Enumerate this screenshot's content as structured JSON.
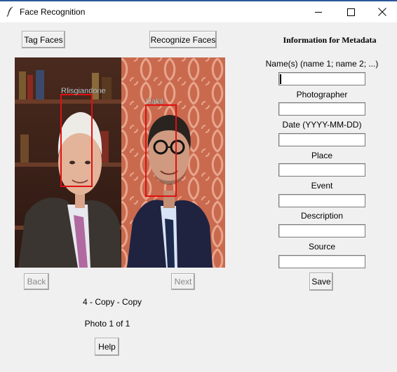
{
  "window": {
    "title": "Face Recognition",
    "accent": "#2b5797"
  },
  "toolbar": {
    "tag_faces": "Tag Faces",
    "recognize_faces": "Recognize Faces"
  },
  "photo": {
    "faces": [
      {
        "name": "Rlisgiandone",
        "box_color": "#e01010"
      },
      {
        "name": "Dalal",
        "box_color": "#e01010"
      }
    ]
  },
  "navigation": {
    "back": "Back",
    "next": "Next",
    "filename": "4 - Copy - Copy",
    "counter": "Photo 1 of 1",
    "help": "Help"
  },
  "metadata": {
    "heading": "Information for Metadata",
    "fields": [
      {
        "label": "Name(s)  (name 1; name 2; ...)",
        "value": ""
      },
      {
        "label": "Photographer",
        "value": ""
      },
      {
        "label": "Date  (YYYY-MM-DD)",
        "value": ""
      },
      {
        "label": "Place",
        "value": ""
      },
      {
        "label": "Event",
        "value": ""
      },
      {
        "label": "Description",
        "value": ""
      },
      {
        "label": "Source",
        "value": ""
      }
    ],
    "save": "Save"
  }
}
